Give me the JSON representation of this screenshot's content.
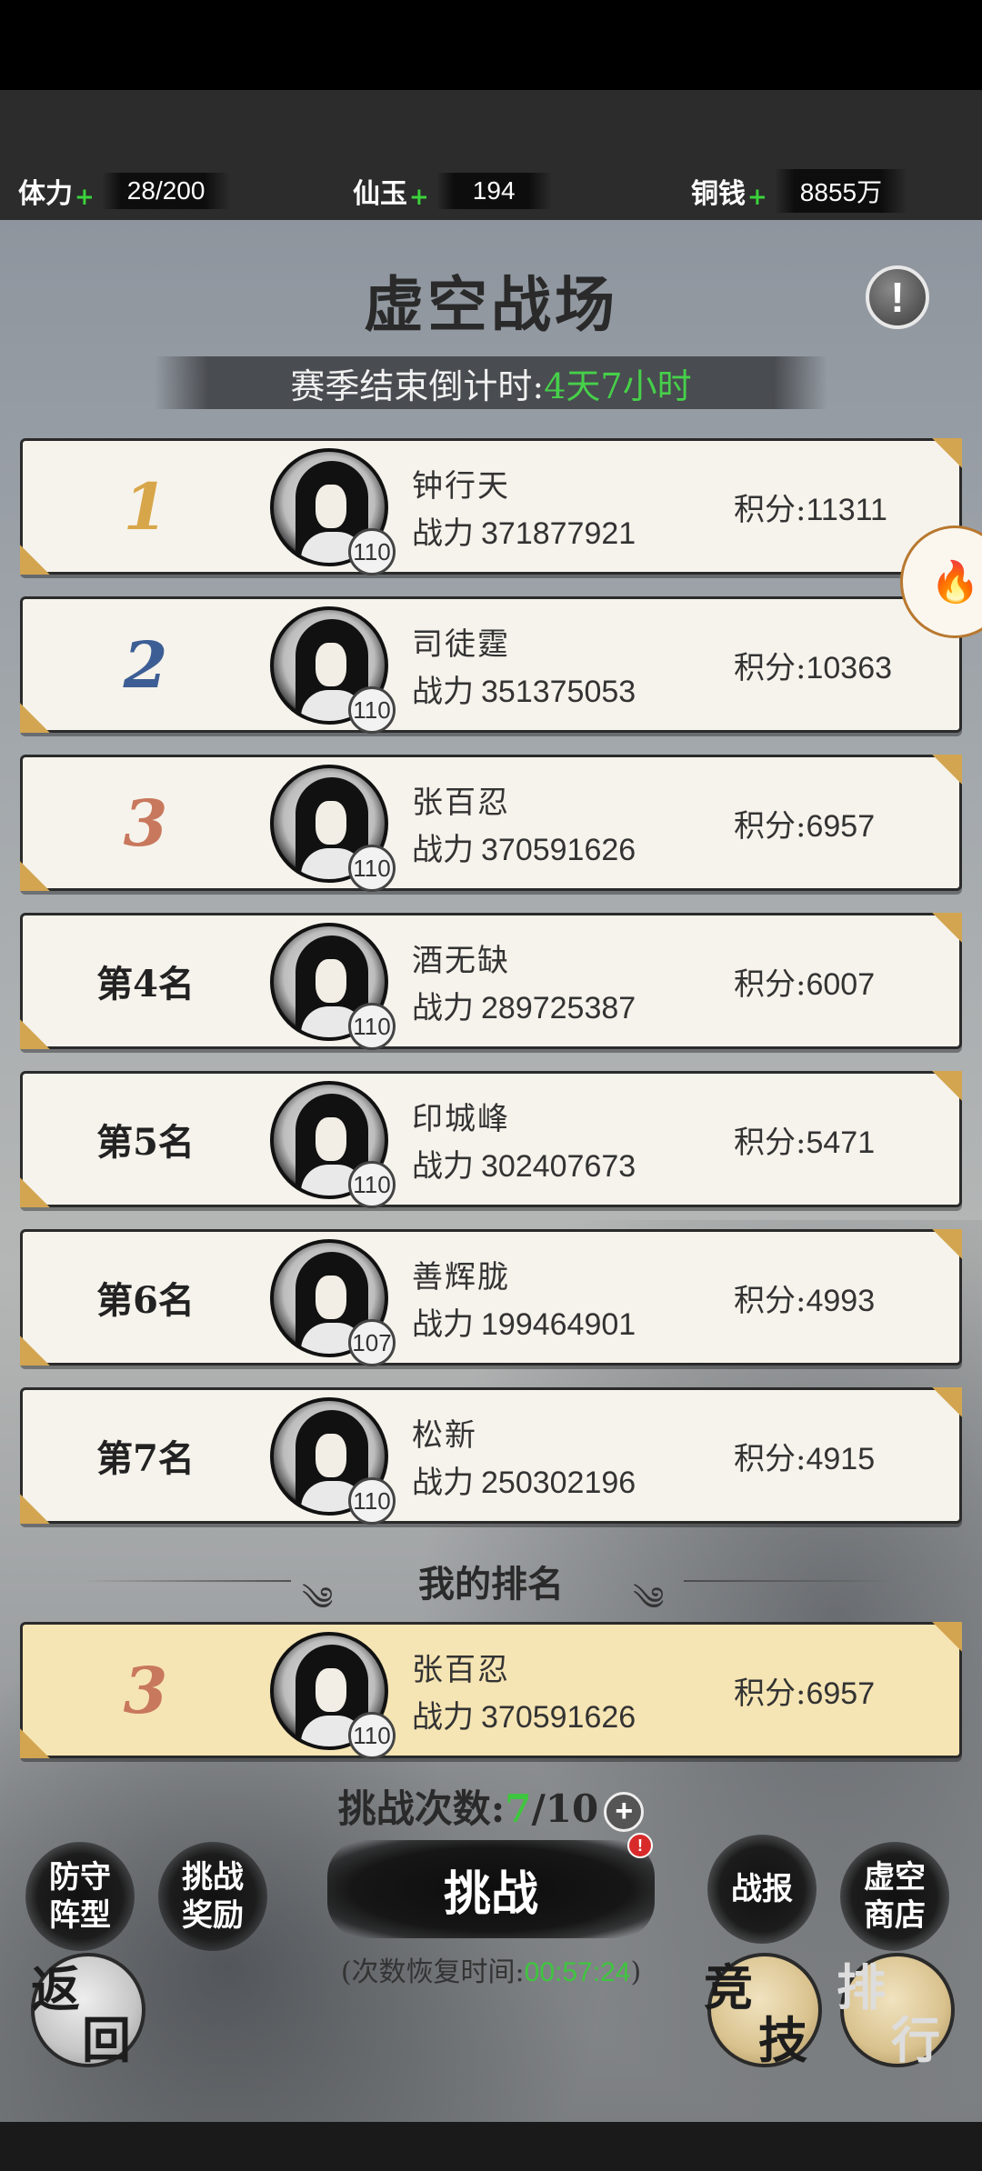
{
  "resources": [
    {
      "label": "体力",
      "value": "28/200"
    },
    {
      "label": "仙玉",
      "value": "194"
    },
    {
      "label": "铜钱",
      "value": "8855万"
    }
  ],
  "title": "虚空战场",
  "countdown": {
    "label": "赛季结束倒计时:",
    "value": "4天7小时"
  },
  "power_label": "战力",
  "score_label": "积分:",
  "rankings": [
    {
      "rank": "1",
      "name": "钟行天",
      "power": "371877921",
      "score": "11311",
      "level": "110"
    },
    {
      "rank": "2",
      "name": "司徒霆",
      "power": "351375053",
      "score": "10363",
      "level": "110"
    },
    {
      "rank": "3",
      "name": "张百忍",
      "power": "370591626",
      "score": "6957",
      "level": "110"
    },
    {
      "rank": "第4名",
      "name": "酒无缺",
      "power": "289725387",
      "score": "6007",
      "level": "110"
    },
    {
      "rank": "第5名",
      "name": "印城峰",
      "power": "302407673",
      "score": "5471",
      "level": "110"
    },
    {
      "rank": "第6名",
      "name": "善辉胧",
      "power": "199464901",
      "score": "4993",
      "level": "107"
    },
    {
      "rank": "第7名",
      "name": "松新",
      "power": "250302196",
      "score": "4915",
      "level": "110"
    }
  ],
  "my_rank_title": "我的排名",
  "my_rank": {
    "rank": "3",
    "name": "张百忍",
    "power": "370591626",
    "score": "6957",
    "level": "110"
  },
  "challenge_count": {
    "label": "挑战次数:",
    "current": "7",
    "total": "/10"
  },
  "buttons": {
    "defense_1": "防守",
    "defense_2": "阵型",
    "reward_1": "挑战",
    "reward_2": "奖励",
    "challenge": "挑战",
    "report": "战报",
    "shop_1": "虚空",
    "shop_2": "商店",
    "back_1": "返",
    "back_2": "回",
    "arena_1": "竞",
    "arena_2": "技",
    "rank_1": "排",
    "rank_2": "行"
  },
  "recover": {
    "prefix": "(次数恢复时间:",
    "time": "00:57:24",
    "suffix": ")"
  },
  "colors": {
    "highlight_green": "#46d04a",
    "gold": "#d8a64a",
    "card_bg": "#f6f3ec",
    "my_card_bg": "#f6e5b4"
  }
}
